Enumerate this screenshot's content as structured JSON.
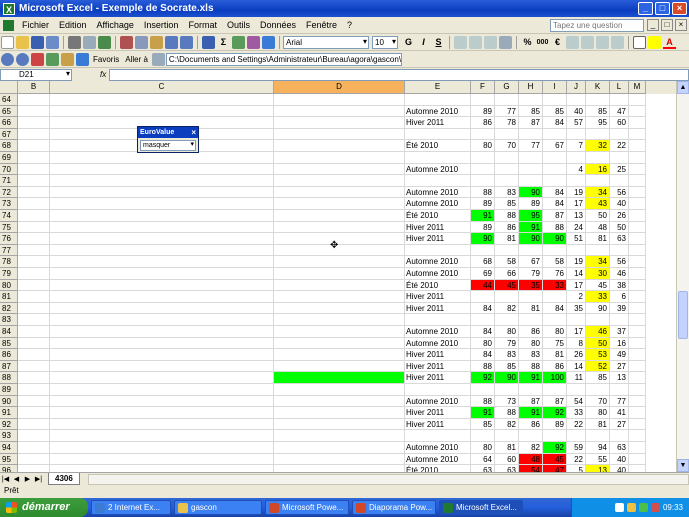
{
  "window": {
    "title": "Microsoft Excel - Exemple de Socrate.xls",
    "min": "_",
    "max": "□",
    "close": "×"
  },
  "menu": {
    "items": [
      "Fichier",
      "Edition",
      "Affichage",
      "Insertion",
      "Format",
      "Outils",
      "Données",
      "Fenêtre",
      "?"
    ],
    "help_placeholder": "Tapez une question",
    "doc_min": "_",
    "doc_restore": "□",
    "doc_close": "×"
  },
  "toolbar": {
    "font_name": "Arial",
    "font_size": "10",
    "bold": "G",
    "italic": "I",
    "underline": "S",
    "percent": "%",
    "thousands": "000",
    "euro": "€",
    "font_color": "A",
    "favorites": "Favoris",
    "goto": "Aller à",
    "address": "C:\\Documents and Settings\\Administrateur\\Bureau\\agora\\gascon\\E"
  },
  "formula_bar": {
    "name_box": "D21",
    "fx": "fx",
    "value": ""
  },
  "columns": [
    {
      "key": "B",
      "label": "B"
    },
    {
      "key": "C",
      "label": "C"
    },
    {
      "key": "D",
      "label": "D",
      "active": true
    },
    {
      "key": "E",
      "label": "E"
    },
    {
      "key": "F",
      "label": "F"
    },
    {
      "key": "G",
      "label": "G"
    },
    {
      "key": "H",
      "label": "H"
    },
    {
      "key": "I",
      "label": "I"
    },
    {
      "key": "J",
      "label": "J"
    },
    {
      "key": "K",
      "label": "K"
    },
    {
      "key": "L",
      "label": "L"
    },
    {
      "key": "M",
      "label": "M"
    }
  ],
  "rows": [
    {
      "n": "64",
      "E": "",
      "F": "",
      "G": "",
      "H": "",
      "I": "",
      "J": "",
      "K": "",
      "L": ""
    },
    {
      "n": "65",
      "E": "Automne 2010",
      "F": "89",
      "G": "77",
      "H": "85",
      "I": "85",
      "J": "40",
      "K": "85",
      "L": "47"
    },
    {
      "n": "66",
      "E": "Hiver 2011",
      "F": "86",
      "G": "78",
      "H": "87",
      "I": "84",
      "J": "57",
      "K": "95",
      "L": "60"
    },
    {
      "n": "67",
      "E": "",
      "F": "",
      "G": "",
      "H": "",
      "I": "",
      "J": "",
      "K": "",
      "L": ""
    },
    {
      "n": "68",
      "E": "Été 2010",
      "F": "80",
      "G": "70",
      "H": "77",
      "I": "67",
      "J": "7",
      "K": "32",
      "L": "22",
      "bg": {
        "K": "yellow"
      }
    },
    {
      "n": "69",
      "E": "",
      "F": "",
      "G": "",
      "H": "",
      "I": "",
      "J": "",
      "K": "",
      "L": ""
    },
    {
      "n": "70",
      "E": "Automne 2010",
      "F": "",
      "G": "",
      "H": "",
      "I": "",
      "J": "4",
      "K": "16",
      "L": "25",
      "bg": {
        "K": "yellow"
      }
    },
    {
      "n": "71",
      "E": "",
      "F": "",
      "G": "",
      "H": "",
      "I": "",
      "J": "",
      "K": "",
      "L": ""
    },
    {
      "n": "72",
      "E": "Automne 2010",
      "F": "88",
      "G": "83",
      "H": "90",
      "I": "84",
      "J": "19",
      "K": "34",
      "L": "56",
      "bg": {
        "H": "green",
        "K": "yellow"
      }
    },
    {
      "n": "73",
      "E": "Automne 2010",
      "F": "89",
      "G": "85",
      "H": "89",
      "I": "84",
      "J": "17",
      "K": "43",
      "L": "40",
      "bg": {
        "K": "yellow"
      }
    },
    {
      "n": "74",
      "E": "Été 2010",
      "F": "91",
      "G": "88",
      "H": "95",
      "I": "87",
      "J": "13",
      "K": "50",
      "L": "26",
      "bg": {
        "F": "green",
        "H": "green"
      }
    },
    {
      "n": "75",
      "E": "Hiver 2011",
      "F": "89",
      "G": "86",
      "H": "91",
      "I": "88",
      "J": "24",
      "K": "48",
      "L": "50",
      "bg": {
        "H": "green"
      }
    },
    {
      "n": "76",
      "E": "Hiver 2011",
      "F": "90",
      "G": "81",
      "H": "90",
      "I": "90",
      "J": "51",
      "K": "81",
      "L": "63",
      "bg": {
        "F": "green",
        "H": "green",
        "I": "green"
      }
    },
    {
      "n": "77",
      "E": "",
      "F": "",
      "G": "",
      "H": "",
      "I": "",
      "J": "",
      "K": "",
      "L": ""
    },
    {
      "n": "78",
      "E": "Automne 2010",
      "F": "68",
      "G": "58",
      "H": "67",
      "I": "58",
      "J": "19",
      "K": "34",
      "L": "56",
      "bg": {
        "K": "yellow"
      }
    },
    {
      "n": "79",
      "E": "Automne 2010",
      "F": "69",
      "G": "66",
      "H": "79",
      "I": "76",
      "J": "14",
      "K": "30",
      "L": "46",
      "bg": {
        "K": "yellow"
      }
    },
    {
      "n": "80",
      "E": "Été 2010",
      "F": "44",
      "G": "45",
      "H": "35",
      "I": "33",
      "J": "17",
      "K": "45",
      "L": "38",
      "bg": {
        "F": "red",
        "G": "red",
        "H": "red",
        "I": "red"
      }
    },
    {
      "n": "81",
      "E": "Hiver 2011",
      "F": "",
      "G": "",
      "H": "",
      "I": "",
      "J": "2",
      "K": "33",
      "L": "6",
      "bg": {
        "K": "yellow"
      }
    },
    {
      "n": "82",
      "E": "Hiver 2011",
      "F": "84",
      "G": "82",
      "H": "81",
      "I": "84",
      "J": "35",
      "K": "90",
      "L": "39"
    },
    {
      "n": "83",
      "E": "",
      "F": "",
      "G": "",
      "H": "",
      "I": "",
      "J": "",
      "K": "",
      "L": ""
    },
    {
      "n": "84",
      "E": "Automne 2010",
      "F": "84",
      "G": "80",
      "H": "86",
      "I": "80",
      "J": "17",
      "K": "46",
      "L": "37",
      "bg": {
        "K": "yellow"
      }
    },
    {
      "n": "85",
      "E": "Automne 2010",
      "F": "80",
      "G": "79",
      "H": "80",
      "I": "75",
      "J": "8",
      "K": "50",
      "L": "16",
      "bg": {
        "K": "yellow"
      }
    },
    {
      "n": "86",
      "E": "Hiver 2011",
      "F": "84",
      "G": "83",
      "H": "83",
      "I": "81",
      "J": "26",
      "K": "53",
      "L": "49",
      "bg": {
        "K": "yellow"
      }
    },
    {
      "n": "87",
      "E": "Hiver 2011",
      "F": "88",
      "G": "85",
      "H": "88",
      "I": "86",
      "J": "14",
      "K": "52",
      "L": "27",
      "bg": {
        "K": "yellow"
      }
    },
    {
      "n": "88",
      "E": "Hiver 2011",
      "F": "92",
      "G": "90",
      "H": "91",
      "I": "100",
      "J": "11",
      "K": "85",
      "L": "13",
      "bg": {
        "D": "green",
        "F": "green",
        "G": "green",
        "H": "green",
        "I": "green"
      }
    },
    {
      "n": "89",
      "E": "",
      "F": "",
      "G": "",
      "H": "",
      "I": "",
      "J": "",
      "K": "",
      "L": ""
    },
    {
      "n": "90",
      "E": "Automne 2010",
      "F": "88",
      "G": "73",
      "H": "87",
      "I": "87",
      "J": "54",
      "K": "70",
      "L": "77"
    },
    {
      "n": "91",
      "E": "Hiver 2011",
      "F": "91",
      "G": "88",
      "H": "91",
      "I": "92",
      "J": "33",
      "K": "80",
      "L": "41",
      "bg": {
        "F": "green",
        "H": "green",
        "I": "green"
      }
    },
    {
      "n": "92",
      "E": "Hiver 2011",
      "F": "85",
      "G": "82",
      "H": "86",
      "I": "89",
      "J": "22",
      "K": "81",
      "L": "27"
    },
    {
      "n": "93",
      "E": "",
      "F": "",
      "G": "",
      "H": "",
      "I": "",
      "J": "",
      "K": "",
      "L": ""
    },
    {
      "n": "94",
      "E": "Automne 2010",
      "F": "80",
      "G": "81",
      "H": "82",
      "I": "92",
      "J": "59",
      "K": "94",
      "L": "63",
      "bg": {
        "I": "green"
      }
    },
    {
      "n": "95",
      "E": "Automne 2010",
      "F": "64",
      "G": "60",
      "H": "48",
      "I": "45",
      "J": "22",
      "K": "55",
      "L": "40",
      "bg": {
        "H": "red",
        "I": "red"
      }
    },
    {
      "n": "96",
      "E": "Été 2010",
      "F": "63",
      "G": "63",
      "H": "54",
      "I": "47",
      "J": "5",
      "K": "13",
      "L": "40",
      "bg": {
        "H": "red",
        "I": "red",
        "K": "yellow"
      }
    }
  ],
  "float_toolbar": {
    "title": "EuroValue",
    "close": "×",
    "value": "masquer"
  },
  "sheet_tab": "4306",
  "status": "Prêt",
  "taskbar": {
    "start": "démarrer",
    "tasks": [
      {
        "label": "2 Internet Ex...",
        "color": "#3a7bd5"
      },
      {
        "label": "gascon",
        "color": "#e8c24a"
      },
      {
        "label": "Microsoft Powe...",
        "color": "#d24726"
      },
      {
        "label": "Diaporama Pow...",
        "color": "#d24726"
      },
      {
        "label": "Microsoft Excel...",
        "color": "#1f7a2f",
        "active": true
      }
    ],
    "clock": "09:33"
  },
  "colors": {
    "green": "#00ff00",
    "red": "#ff0000",
    "yellow": "#ffff00",
    "active_column": "#f7b25e"
  }
}
